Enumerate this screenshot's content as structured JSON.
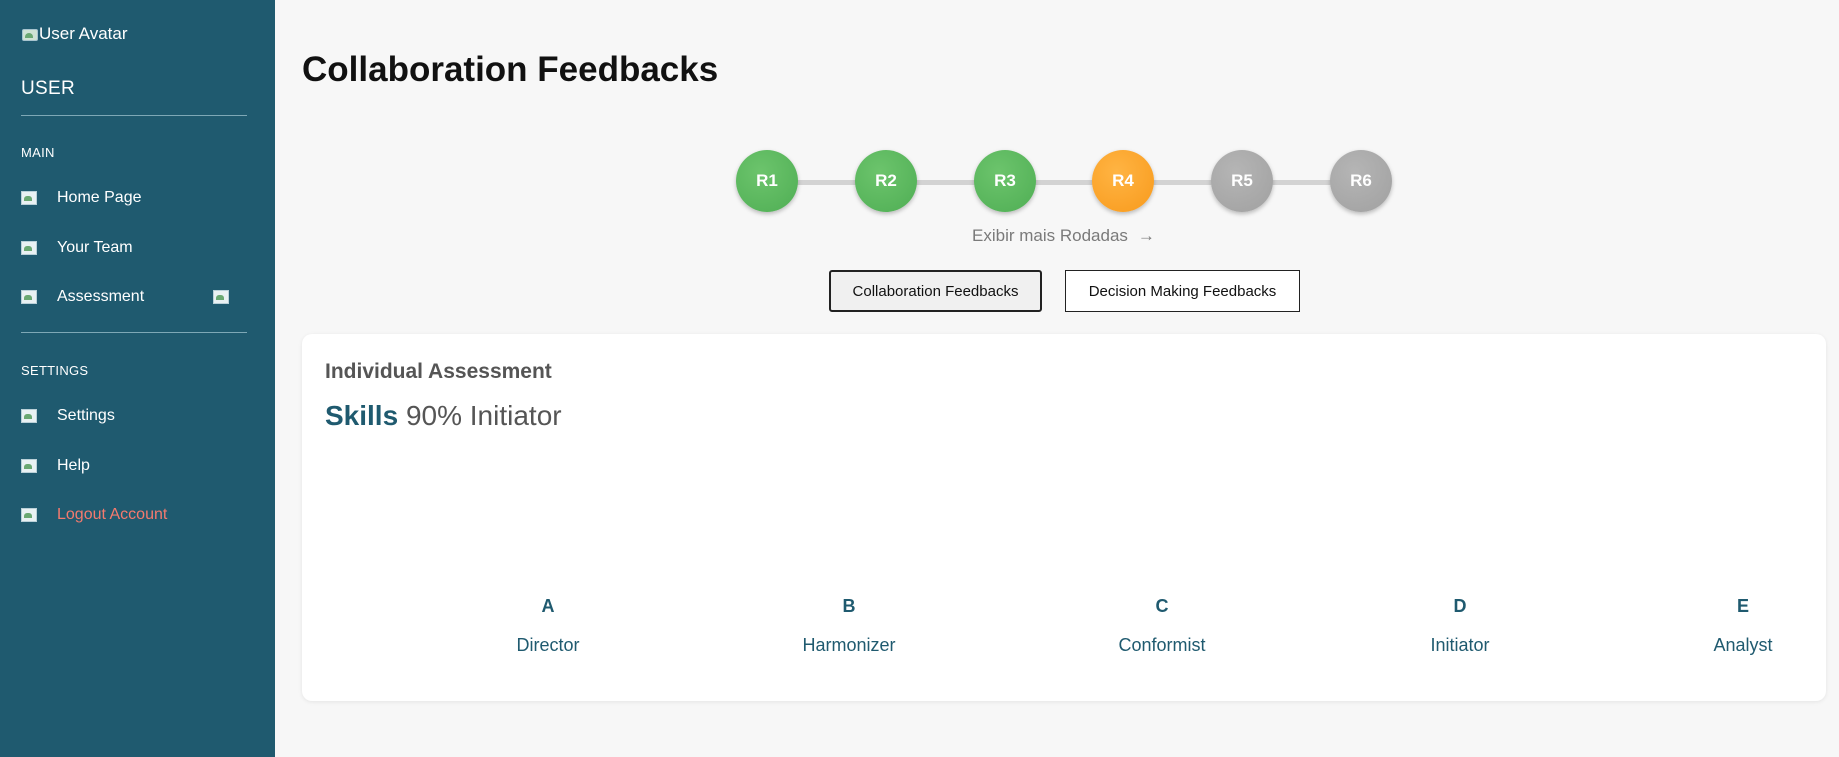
{
  "sidebar": {
    "avatar_alt": "User Avatar",
    "user_label": "USER",
    "main_section": "MAIN",
    "main_items": [
      {
        "label": "Home Page"
      },
      {
        "label": "Your Team"
      },
      {
        "label": "Assessment"
      }
    ],
    "settings_section": "SETTINGS",
    "settings_items": [
      {
        "label": "Settings"
      },
      {
        "label": "Help"
      }
    ],
    "logout_label": "Logout Account"
  },
  "main": {
    "title": "Collaboration Feedbacks",
    "rounds": [
      {
        "label": "R1",
        "status": "done"
      },
      {
        "label": "R2",
        "status": "done"
      },
      {
        "label": "R3",
        "status": "done"
      },
      {
        "label": "R4",
        "status": "active"
      },
      {
        "label": "R5",
        "status": "pending"
      },
      {
        "label": "R6",
        "status": "pending"
      }
    ],
    "more_rounds_label": "Exibir mais Rodadas",
    "more_rounds_arrow": "→",
    "tabs": [
      {
        "label": "Collaboration Feedbacks",
        "selected": true
      },
      {
        "label": "Decision Making Feedbacks",
        "selected": false
      }
    ],
    "card": {
      "title": "Individual Assessment",
      "skills_word": "Skills",
      "skills_value": "90% Initiator",
      "profiles": [
        {
          "letter": "A",
          "name": "Director"
        },
        {
          "letter": "B",
          "name": "Harmonizer"
        },
        {
          "letter": "C",
          "name": "Conformist"
        },
        {
          "letter": "D",
          "name": "Initiator"
        },
        {
          "letter": "E",
          "name": "Analyst"
        }
      ]
    }
  },
  "colors": {
    "sidebar_bg": "#1f5a6f",
    "done": "#5cb85c",
    "active": "#f89a1c",
    "pending": "#a0a0a0",
    "logout": "#f47a6e"
  }
}
